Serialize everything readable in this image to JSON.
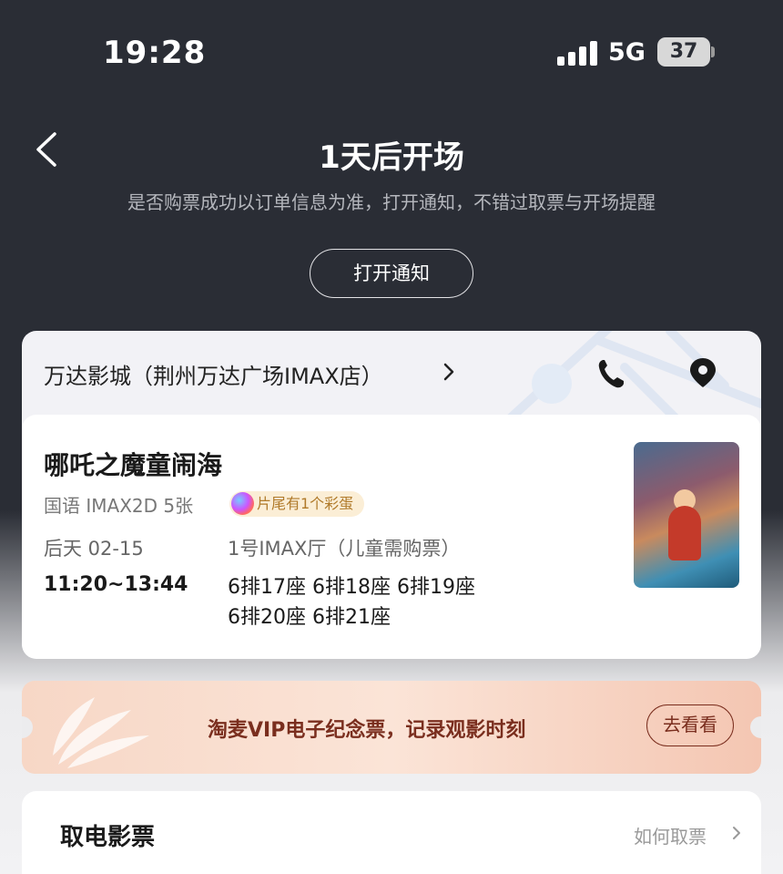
{
  "status_bar": {
    "time": "19:28",
    "network": "5G",
    "battery": "37"
  },
  "header": {
    "title": "1天后开场",
    "subtitle": "是否购票成功以订单信息为准，打开通知，不错过取票与开场提醒",
    "notify_button": "打开通知"
  },
  "cinema": {
    "name": "万达影城（荆州万达广场IMAX店）",
    "movie": {
      "title": "哪吒之魔童闹海",
      "meta": "国语 IMAX2D 5张",
      "easter_egg": "片尾有1个彩蛋",
      "date": "后天 02-15",
      "time": "11:20~13:44",
      "hall": "1号IMAX厅（儿童需购票）",
      "seats_line1": "6排17座 6排18座 6排19座",
      "seats_line2": "6排20座 6排21座"
    }
  },
  "vip_banner": {
    "text": "淘麦VIP电子纪念票，记录观影时刻",
    "button": "去看看"
  },
  "pickup": {
    "title": "取电影票",
    "link": "如何取票"
  },
  "colors": {
    "header_bg": "#2a2d35",
    "vip_text": "#7a2e1e",
    "badge_text": "#b07a2a"
  }
}
